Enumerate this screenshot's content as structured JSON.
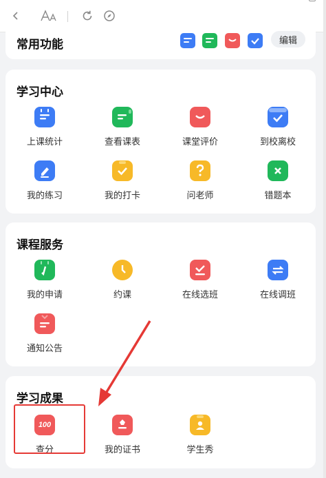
{
  "colors": {
    "blue": "#3d7cf5",
    "green": "#20b85a",
    "red": "#f0595a",
    "yellow": "#f7b928",
    "orange": "#f5a623",
    "arrow": "#e53935"
  },
  "toolbar": {
    "back_icon": "chevron-left-icon",
    "font_icon": "font-size-icon",
    "font_glyph": "A​A",
    "refresh_icon": "refresh-icon",
    "compass_icon": "compass-icon"
  },
  "quick": {
    "title": "常用功能",
    "edit_label": "编辑",
    "icons": [
      "doc-icon",
      "doc-icon",
      "chat-icon",
      "check-icon"
    ]
  },
  "study_center": {
    "title": "学习中心",
    "items": [
      {
        "label": "上课统计",
        "icon": "stats-icon"
      },
      {
        "label": "查看课表",
        "icon": "schedule-icon"
      },
      {
        "label": "课堂评价",
        "icon": "smile-chat-icon"
      },
      {
        "label": "到校离校",
        "icon": "check-calendar-icon"
      },
      {
        "label": "我的练习",
        "icon": "pencil-icon"
      },
      {
        "label": "我的打卡",
        "icon": "clipboard-check-icon"
      },
      {
        "label": "问老师",
        "icon": "question-icon"
      },
      {
        "label": "错题本",
        "icon": "cross-book-icon"
      }
    ]
  },
  "course_service": {
    "title": "课程服务",
    "items": [
      {
        "label": "我的申请",
        "icon": "apply-icon"
      },
      {
        "label": "约课",
        "icon": "clock-icon"
      },
      {
        "label": "在线选班",
        "icon": "select-class-icon"
      },
      {
        "label": "在线调班",
        "icon": "swap-icon"
      },
      {
        "label": "通知公告",
        "icon": "notice-icon"
      }
    ]
  },
  "achievements": {
    "title": "学习成果",
    "items": [
      {
        "label": "查分",
        "icon": "score-icon",
        "badge": "100"
      },
      {
        "label": "我的证书",
        "icon": "certificate-icon"
      },
      {
        "label": "学生秀",
        "icon": "student-show-icon"
      }
    ]
  }
}
